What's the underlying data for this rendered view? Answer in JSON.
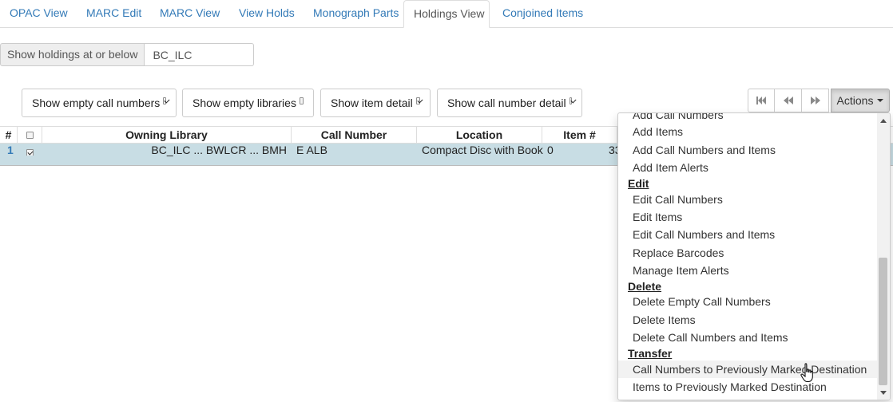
{
  "tabs": [
    {
      "label": "OPAC View",
      "active": false
    },
    {
      "label": "MARC Edit",
      "active": false
    },
    {
      "label": "MARC View",
      "active": false
    },
    {
      "label": "View Holds",
      "active": false
    },
    {
      "label": "Monograph Parts",
      "active": false
    },
    {
      "label": "Holdings View",
      "active": true
    },
    {
      "label": "Conjoined Items",
      "active": false
    }
  ],
  "holdings_filter": {
    "label": "Show holdings at or below",
    "value": "BC_ILC"
  },
  "options": [
    {
      "label": "Show empty call numbers",
      "checked": true
    },
    {
      "label": "Show empty libraries",
      "checked": false
    },
    {
      "label": "Show item detail",
      "checked": true
    },
    {
      "label": "Show call number detail",
      "checked": true
    }
  ],
  "pager": {
    "first_icon": "skip-backward-icon",
    "prev_icon": "backward-icon",
    "next_icon": "forward-icon"
  },
  "actions": {
    "label": "Actions"
  },
  "grid": {
    "columns": [
      "#",
      "",
      "Owning Library",
      "Call Number",
      "Location",
      "Item #"
    ],
    "rows": [
      {
        "num": "1",
        "selected": true,
        "owning_library": "BC_ILC ... BWLCR ... BMH",
        "call_number": "E ALB",
        "location": "Compact Disc with Book",
        "item_num": "0",
        "barcode_partial": "33"
      }
    ]
  },
  "menu": {
    "cut_item": "Add Call Numbers",
    "add_items": [
      "Add Items",
      "Add Call Numbers and Items",
      "Add Item Alerts"
    ],
    "edit_header": "Edit",
    "edit_items": [
      "Edit Call Numbers",
      "Edit Items",
      "Edit Call Numbers and Items",
      "Replace Barcodes",
      "Manage Item Alerts"
    ],
    "delete_header": "Delete",
    "delete_items": [
      "Delete Empty Call Numbers",
      "Delete Items",
      "Delete Call Numbers and Items"
    ],
    "transfer_header": "Transfer",
    "transfer_items": [
      "Call Numbers to Previously Marked Destination",
      "Items to Previously Marked Destination"
    ],
    "highlighted": "Call Numbers to Previously Marked Destination"
  }
}
